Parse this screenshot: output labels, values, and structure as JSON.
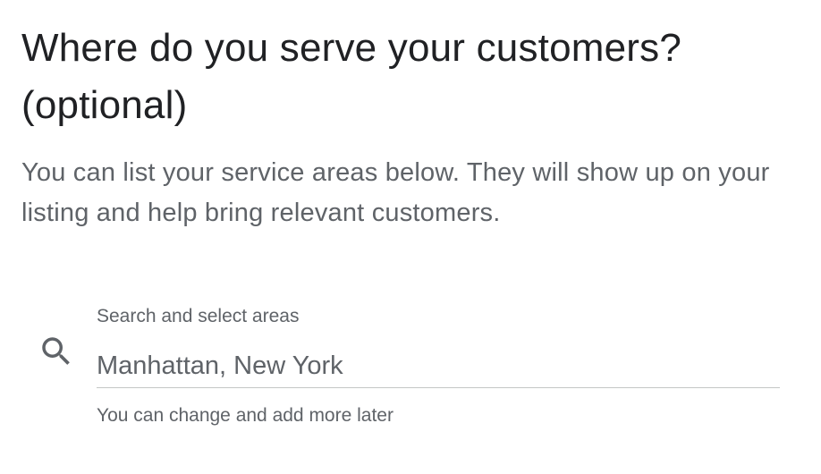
{
  "header": {
    "title": "Where do you serve your customers? (optional)"
  },
  "intro": {
    "description": "You can list your service areas below. They will show up on your listing and help bring relevant customers."
  },
  "search": {
    "label": "Search and select areas",
    "placeholder": "Manhattan, New York",
    "helper": "You can change and add more later",
    "icon": "search-icon"
  }
}
